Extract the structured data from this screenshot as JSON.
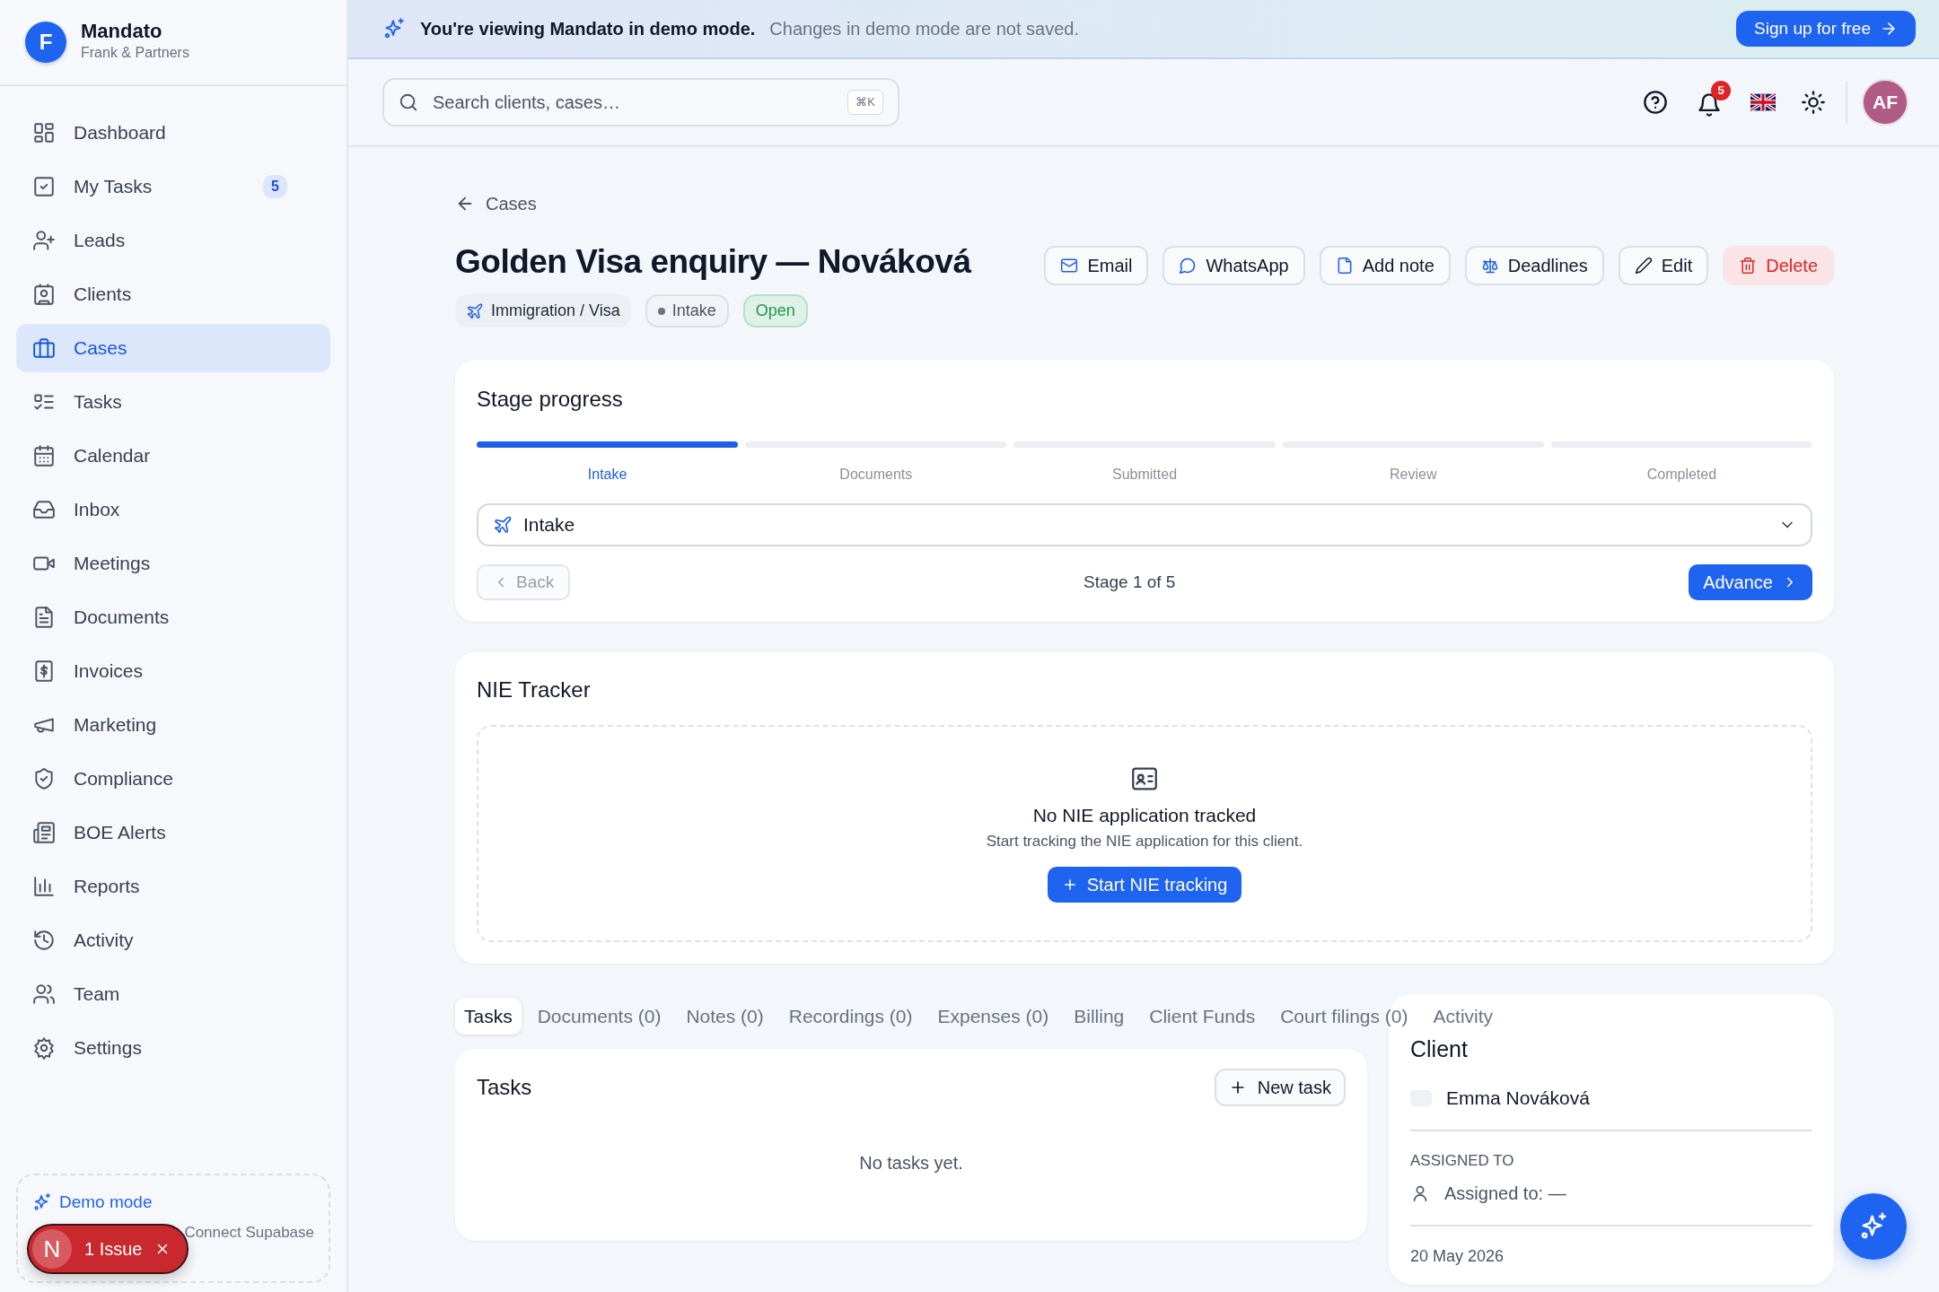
{
  "sidebar": {
    "brand": {
      "initial": "F",
      "name": "Mandato",
      "subtitle": "Frank & Partners"
    },
    "items": [
      {
        "label": "Dashboard",
        "selected": false
      },
      {
        "label": "My Tasks",
        "selected": false,
        "badge": "5"
      },
      {
        "label": "Leads",
        "selected": false
      },
      {
        "label": "Clients",
        "selected": false
      },
      {
        "label": "Cases",
        "selected": true
      },
      {
        "label": "Tasks",
        "selected": false
      },
      {
        "label": "Calendar",
        "selected": false
      },
      {
        "label": "Inbox",
        "selected": false
      },
      {
        "label": "Meetings",
        "selected": false
      },
      {
        "label": "Documents",
        "selected": false
      },
      {
        "label": "Invoices",
        "selected": false
      },
      {
        "label": "Marketing",
        "selected": false
      },
      {
        "label": "Compliance",
        "selected": false
      },
      {
        "label": "BOE Alerts",
        "selected": false
      },
      {
        "label": "Reports",
        "selected": false
      },
      {
        "label": "Activity",
        "selected": false
      },
      {
        "label": "Team",
        "selected": false
      },
      {
        "label": "Settings",
        "selected": false
      }
    ],
    "demo_box": {
      "title": "Demo mode",
      "text": "Connect Supabase"
    }
  },
  "dev_overlay": {
    "initial": "N",
    "label": "1 Issue"
  },
  "banner": {
    "headline": "You're viewing Mandato in demo mode.",
    "text": "Changes in demo mode are not saved.",
    "button": "Sign up for free"
  },
  "topbar": {
    "search": {
      "placeholder": "Search clients, cases…",
      "shortcut": "⌘K"
    },
    "notifications": "5",
    "avatar": "AF"
  },
  "breadcrumb": "Cases",
  "case": {
    "title": "Golden Visa enquiry — Nováková",
    "tags": [
      {
        "kind": "practice",
        "label": "Immigration / Visa"
      },
      {
        "kind": "stage",
        "label": "Intake"
      },
      {
        "kind": "status",
        "label": "Open"
      }
    ],
    "actions": [
      {
        "label": "Email",
        "kind": "default"
      },
      {
        "label": "WhatsApp",
        "kind": "default"
      },
      {
        "label": "Add note",
        "kind": "default"
      },
      {
        "label": "Deadlines",
        "kind": "default"
      },
      {
        "label": "Edit",
        "kind": "default"
      },
      {
        "label": "Delete",
        "kind": "danger"
      }
    ]
  },
  "stage_progress": {
    "title": "Stage progress",
    "stages": [
      {
        "label": "Intake",
        "selected": true
      },
      {
        "label": "Documents",
        "selected": false
      },
      {
        "label": "Submitted",
        "selected": false
      },
      {
        "label": "Review",
        "selected": false
      },
      {
        "label": "Completed",
        "selected": false
      }
    ],
    "select_value": "Intake",
    "back": {
      "label": "Back",
      "disabled": true
    },
    "counter": "Stage 1 of 5",
    "advance": "Advance"
  },
  "nie_tracker": {
    "title": "NIE Tracker",
    "empty_title": "No NIE application tracked",
    "empty_text": "Start tracking the NIE application for this client.",
    "button": "Start NIE tracking"
  },
  "tabs": [
    {
      "label": "Tasks",
      "selected": true
    },
    {
      "label": "Documents (0)",
      "selected": false
    },
    {
      "label": "Notes (0)",
      "selected": false
    },
    {
      "label": "Recordings (0)",
      "selected": false
    },
    {
      "label": "Expenses (0)",
      "selected": false
    },
    {
      "label": "Billing",
      "selected": false
    },
    {
      "label": "Client Funds",
      "selected": false
    },
    {
      "label": "Court filings (0)",
      "selected": false
    },
    {
      "label": "Activity",
      "selected": false
    }
  ],
  "tasks": {
    "title": "Tasks",
    "button": "New task",
    "empty": "No tasks yet."
  },
  "client": {
    "title": "Client",
    "name": "Emma Nováková",
    "assigned_heading": "ASSIGNED TO",
    "assigned": "Assigned to: —",
    "date": "20 May 2026"
  }
}
